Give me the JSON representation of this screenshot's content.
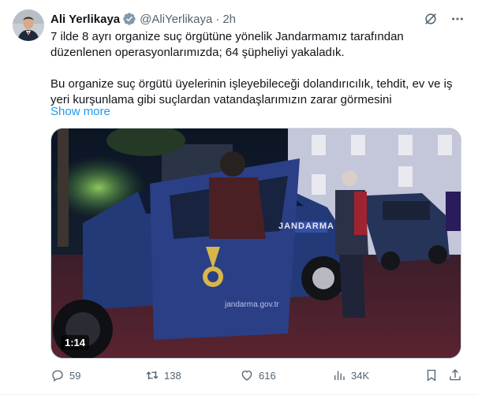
{
  "author": {
    "name": "Ali Yerlikaya",
    "handle": "@AliYerlikaya",
    "separator": "·",
    "time": "2h",
    "verified_badge_color": "#829aab"
  },
  "tweet": {
    "paragraph_1": "7 ilde 8 ayrı organize suç örgütüne yönelik Jandarmamız tarafından düzenlenen operasyonlarımızda; 64 şüpheliyi yakaladık.",
    "paragraph_2": "Bu organize suç örgütü üyelerinin işleyebileceği dolandırıcılık, tehdit, ev ve iş yeri kurşunlama gibi suçlardan vatandaşlarımızın zarar görmesini",
    "show_more": "Show more"
  },
  "media": {
    "duration": "1:14",
    "vehicle_text": "JANDARMA",
    "vehicle_url": "jandarma.gov.tr"
  },
  "actions": {
    "reply_count": "59",
    "retweet_count": "138",
    "like_count": "616",
    "views_count": "34K"
  },
  "icons": [
    "verified-badge-icon",
    "grok-icon",
    "more-icon",
    "reply-icon",
    "retweet-icon",
    "like-icon",
    "views-icon",
    "bookmark-icon",
    "share-icon"
  ],
  "colors": {
    "link": "#1d9bf0",
    "secondary_text": "#536471",
    "primary_text": "#0f1419"
  }
}
